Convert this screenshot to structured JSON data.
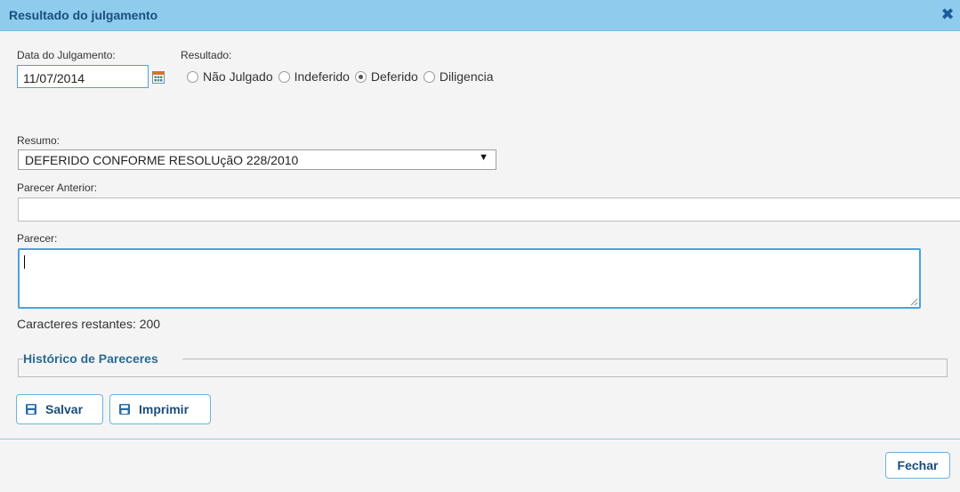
{
  "dialog": {
    "title": "Resultado do julgamento",
    "close_icon": "close-x-icon"
  },
  "form": {
    "date_label": "Data do Julgamento:",
    "date_value": "11/07/2014",
    "calendar_icon": "calendar-icon",
    "result_label": "Resultado:",
    "result_options": [
      {
        "label": "Não Julgado",
        "checked": false
      },
      {
        "label": "Indeferido",
        "checked": false
      },
      {
        "label": "Deferido",
        "checked": true
      },
      {
        "label": "Diligencia",
        "checked": false
      }
    ],
    "summary_label": "Resumo:",
    "summary_selected": "DEFERIDO CONFORME RESOLUçãO 228/2010",
    "previous_label": "Parecer Anterior:",
    "previous_value": "",
    "opinion_label": "Parecer:",
    "opinion_value": "",
    "chars_remaining": "Caracteres restantes: 200",
    "history_legend": "Histórico de Pareceres"
  },
  "actions": {
    "save_label": "Salvar",
    "print_label": "Imprimir",
    "close_label": "Fechar"
  },
  "colors": {
    "titlebar": "#8ecbed",
    "accent_border": "#4ba3d8",
    "button_text": "#1a4c7c"
  }
}
